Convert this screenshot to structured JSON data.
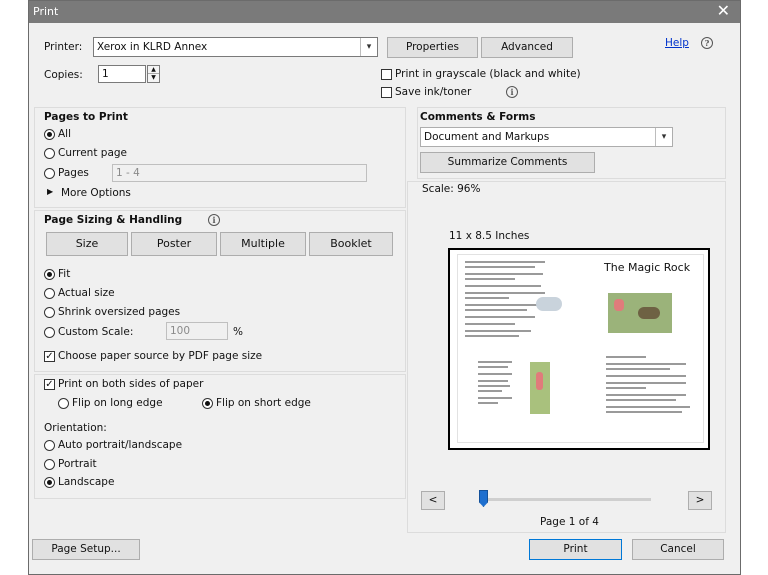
{
  "title": "Print",
  "printer": {
    "label": "Printer:",
    "value": "Xerox in KLRD Annex"
  },
  "copies": {
    "label": "Copies:",
    "value": "1"
  },
  "buttons": {
    "properties": "Properties",
    "advanced": "Advanced",
    "help": "Help",
    "summarize": "Summarize Comments",
    "page_setup": "Page Setup...",
    "print": "Print",
    "cancel": "Cancel",
    "prev": "<",
    "next": ">"
  },
  "options": {
    "grayscale": "Print in grayscale (black and white)",
    "save_ink": "Save ink/toner"
  },
  "pages_to_print": {
    "title": "Pages to Print",
    "all": "All",
    "current": "Current page",
    "pages": "Pages",
    "range": "1 - 4",
    "more": "More Options"
  },
  "sizing": {
    "title": "Page Sizing & Handling",
    "tabs": [
      "Size",
      "Poster",
      "Multiple",
      "Booklet"
    ],
    "fit": "Fit",
    "actual": "Actual size",
    "shrink": "Shrink oversized pages",
    "custom": "Custom Scale:",
    "custom_value": "100",
    "percent": "%",
    "paper_source": "Choose paper source by PDF page size"
  },
  "duplex": {
    "both_sides": "Print on both sides of paper",
    "long_edge": "Flip on long edge",
    "short_edge": "Flip on short edge"
  },
  "orientation": {
    "title": "Orientation:",
    "auto": "Auto portrait/landscape",
    "portrait": "Portrait",
    "landscape": "Landscape"
  },
  "comments": {
    "title": "Comments & Forms",
    "value": "Document and Markups"
  },
  "preview": {
    "scale": "Scale:  96%",
    "size": "11 x 8.5 Inches",
    "page_title": "The Magic Rock",
    "page_indicator": "Page 1 of 4",
    "slider_fraction": 0.0
  }
}
